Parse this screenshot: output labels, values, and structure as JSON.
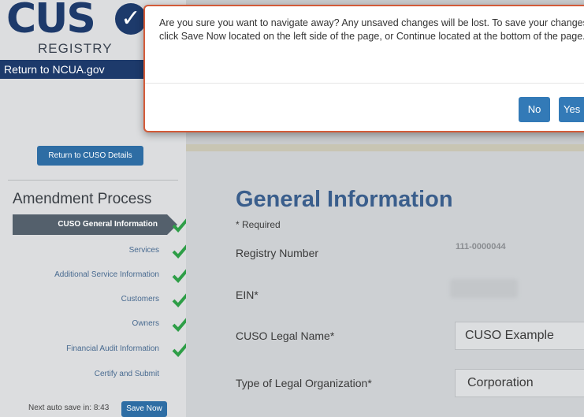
{
  "logo": {
    "text": "CUS",
    "subtitle": "REGISTRY",
    "icon": "check-circle-icon"
  },
  "header": {
    "return_link": "Return to NCUA.gov"
  },
  "sidebar": {
    "return_button": "Return to CUSO Details",
    "amendment_title": "Amendment Process",
    "steps": [
      {
        "label": "CUSO General Information",
        "active": true,
        "complete": true
      },
      {
        "label": "Services",
        "active": false,
        "complete": true
      },
      {
        "label": "Additional Service Information",
        "active": false,
        "complete": true
      },
      {
        "label": "Customers",
        "active": false,
        "complete": true
      },
      {
        "label": "Owners",
        "active": false,
        "complete": true
      },
      {
        "label": "Financial Audit Information",
        "active": false,
        "complete": true
      },
      {
        "label": "Certify and Submit",
        "active": false,
        "complete": false
      }
    ],
    "autosave_text": "Next auto save in: 8:43",
    "save_now": "Save Now"
  },
  "main": {
    "title": "General Information",
    "required_note": "* Required",
    "fields": {
      "registry_number": {
        "label": "Registry Number",
        "value": "111-0000044"
      },
      "ein": {
        "label": "EIN*"
      },
      "legal_name": {
        "label": "CUSO Legal Name*",
        "value": "CUSO Example"
      },
      "org_type": {
        "label": "Type of Legal Organization*",
        "value": "Corporation"
      }
    }
  },
  "dialog": {
    "message": "Are you sure you want to navigate away? Any unsaved changes will be lost. To save your changes, click Save Now located on the left side of the page, or Continue located at the bottom of the page.",
    "no_label": "No",
    "yes_label": "Yes"
  },
  "colors": {
    "navy": "#1d3a6b",
    "button_blue": "#337ab7",
    "check_green": "#2e9e47",
    "dialog_border": "#d35b39"
  }
}
